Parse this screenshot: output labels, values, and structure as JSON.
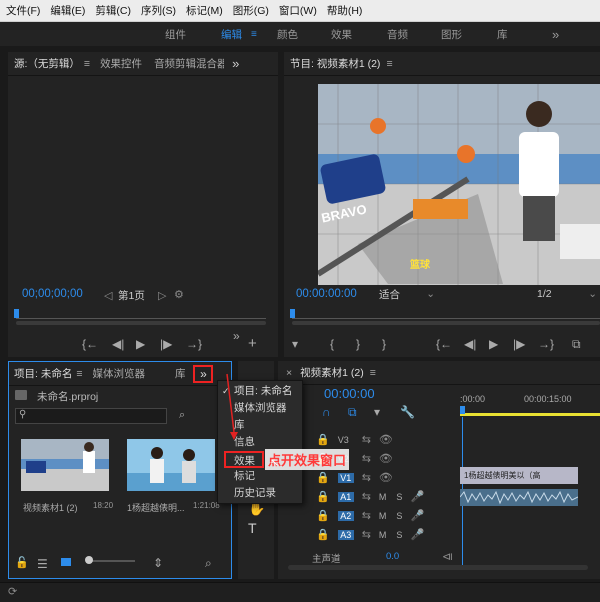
{
  "menubar": [
    "文件(F)",
    "编辑(E)",
    "剪辑(C)",
    "序列(S)",
    "标记(M)",
    "图形(G)",
    "窗口(W)",
    "帮助(H)"
  ],
  "workspaces": {
    "items": [
      "组件",
      "编辑",
      "颜色",
      "效果",
      "音频",
      "图形",
      "库"
    ],
    "active": "编辑",
    "more": "»"
  },
  "source": {
    "tab1": "源:（无剪辑）",
    "tab2": "效果控件",
    "tab3": "音频剪辑混合器",
    "timecode": "00;00;00;00",
    "page": "第1页",
    "more": "»"
  },
  "program": {
    "title": "节目: 视频素材1 (2)",
    "timecode": "00:00:00:00",
    "fit": "适合",
    "ratio": "1/2"
  },
  "video_text": {
    "bravo": "BRAVO",
    "logo": "篮球"
  },
  "project": {
    "tab1": "项目: 未命名",
    "tab2": "媒体浏览器",
    "tab3": "库",
    "file": "未命名.prproj",
    "more": "»",
    "items": [
      {
        "name": "视频素材1 (2)",
        "duration": "18:20"
      },
      {
        "name": "1杨超越俵明...",
        "duration": "1:21:08"
      }
    ]
  },
  "popup": {
    "items": [
      "项目: 未命名",
      "媒体浏览器",
      "库",
      "信息",
      "效果",
      "标记",
      "历史记录"
    ],
    "checked": "项目: 未命名",
    "highlighted": "效果"
  },
  "annotation": "点开效果窗口",
  "timeline": {
    "title": "视频素材1 (2)",
    "timecode": "00:00:00",
    "ruler_start": ":00:00",
    "ruler_mid": "00:00:15:00",
    "tracks": [
      {
        "label": "V3"
      },
      {
        "label": "V2"
      },
      {
        "label": "V1"
      },
      {
        "label": "A1"
      },
      {
        "label": "A2"
      },
      {
        "label": "A3"
      }
    ],
    "master": "主声道",
    "master_val": "0.0",
    "clip_label": "1杨超越俵明美以（高"
  },
  "colors": {
    "accent": "#2d8ceb",
    "annotation_red": "#e22222"
  }
}
